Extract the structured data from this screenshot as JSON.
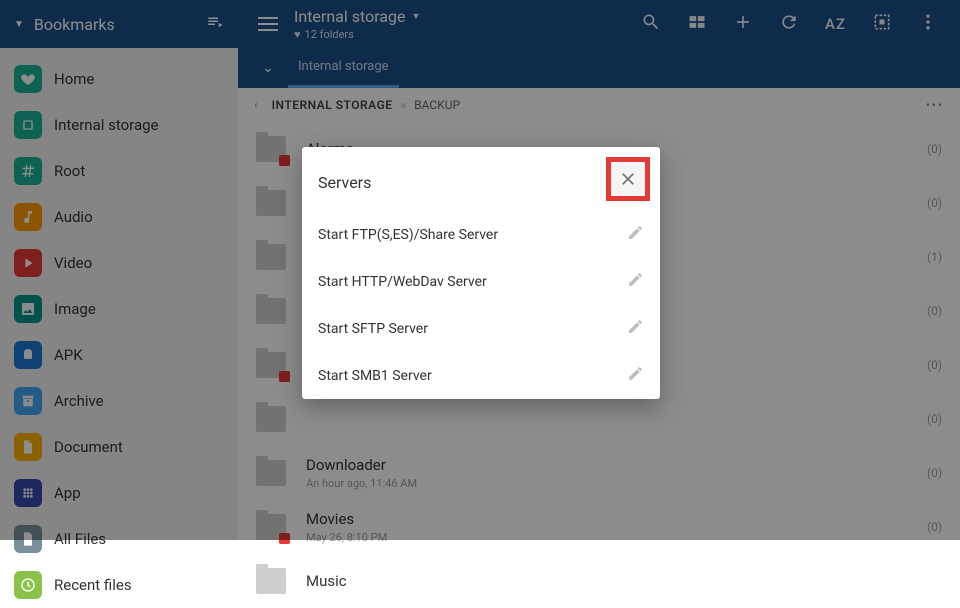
{
  "sidebar": {
    "title": "Bookmarks",
    "items": [
      {
        "label": "Home",
        "icon": "heart",
        "cls": "ic-teal"
      },
      {
        "label": "Internal storage",
        "icon": "storage",
        "cls": "ic-teal"
      },
      {
        "label": "Root",
        "icon": "hash",
        "cls": "ic-teal"
      },
      {
        "label": "Audio",
        "icon": "music",
        "cls": "ic-orange"
      },
      {
        "label": "Video",
        "icon": "play",
        "cls": "ic-red"
      },
      {
        "label": "Image",
        "icon": "image",
        "cls": "ic-teal2"
      },
      {
        "label": "APK",
        "icon": "android",
        "cls": "ic-blue"
      },
      {
        "label": "Archive",
        "icon": "archive",
        "cls": "ic-lblue"
      },
      {
        "label": "Document",
        "icon": "doc",
        "cls": "ic-amber"
      },
      {
        "label": "App",
        "icon": "grid",
        "cls": "ic-indigo"
      },
      {
        "label": "All Files",
        "icon": "files",
        "cls": "ic-grey"
      },
      {
        "label": "Recent files",
        "icon": "clock",
        "cls": "ic-lime"
      }
    ]
  },
  "topbar": {
    "title": "Internal storage",
    "subtitle": "12 folders",
    "az": "AZ"
  },
  "tab": {
    "label": "Internal storage"
  },
  "breadcrumb": {
    "root": "INTERNAL STORAGE",
    "current": "BACKUP"
  },
  "files": [
    {
      "name": "Alarms",
      "sub": "",
      "count": "(0)",
      "badge": "music"
    },
    {
      "name": "",
      "sub": "",
      "count": "(0)"
    },
    {
      "name": "",
      "sub": "",
      "count": "(1)"
    },
    {
      "name": "",
      "sub": "",
      "count": "(0)"
    },
    {
      "name": "",
      "sub": "",
      "count": "(0)",
      "badge": "img"
    },
    {
      "name": "",
      "sub": "",
      "count": "(0)"
    },
    {
      "name": "Downloader",
      "sub": "An hour ago, 11:46 AM",
      "count": "(0)"
    },
    {
      "name": "Movies",
      "sub": "May 26, 8:10 PM",
      "count": "(0)",
      "badge": "vid"
    },
    {
      "name": "Music",
      "sub": "",
      "count": ""
    }
  ],
  "dialog": {
    "title": "Servers",
    "items": [
      {
        "label": "Start FTP(S,ES)/Share Server"
      },
      {
        "label": "Start HTTP/WebDav Server"
      },
      {
        "label": "Start SFTP Server"
      },
      {
        "label": "Start SMB1 Server"
      }
    ]
  }
}
